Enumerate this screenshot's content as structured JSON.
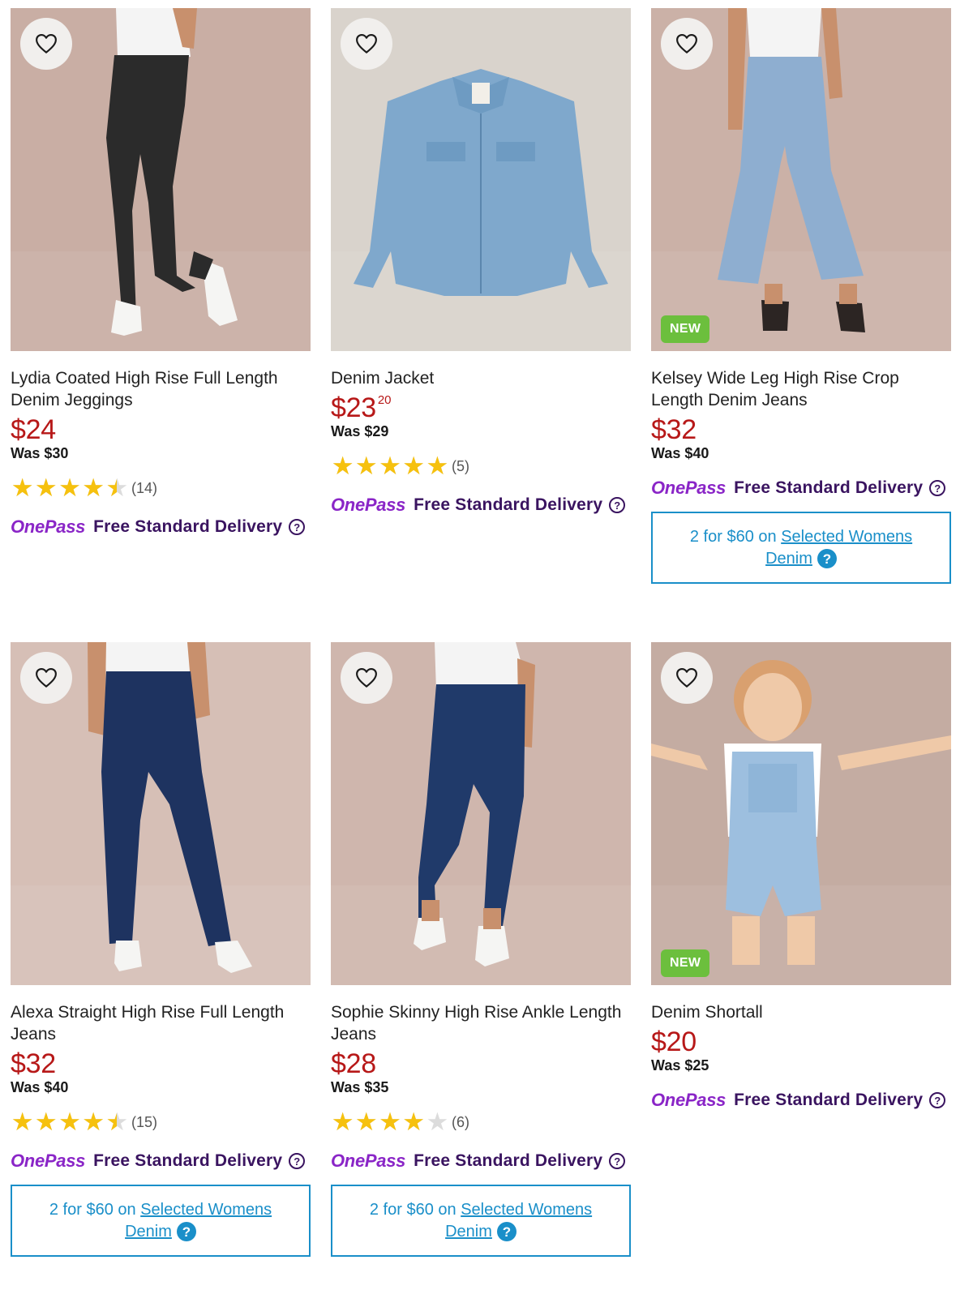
{
  "products": [
    {
      "title": "Lydia Coated High Rise Full Length Denim Jeggings",
      "price": "$24",
      "price_cents": "",
      "was": "Was $30",
      "rating": 4.5,
      "rating_count": "(14)",
      "badge": "",
      "delivery": {
        "brand": "OnePass",
        "text": "Free Standard Delivery",
        "help": "?"
      },
      "promo": null,
      "image": {
        "bg": "#c9aea4",
        "type": "jeggings",
        "color": "#2b2b2b"
      }
    },
    {
      "title": "Denim Jacket",
      "price": "$23",
      "price_cents": "20",
      "was": "Was $29",
      "rating": 5,
      "rating_count": "(5)",
      "badge": "",
      "delivery": {
        "brand": "OnePass",
        "text": "Free Standard Delivery",
        "help": "?"
      },
      "promo": null,
      "image": {
        "bg": "#d9d3cc",
        "type": "jacket",
        "color": "#7fa8cc"
      }
    },
    {
      "title": "Kelsey Wide Leg High Rise Crop Length Denim Jeans",
      "price": "$32",
      "price_cents": "",
      "was": "Was $40",
      "rating": null,
      "rating_count": "",
      "badge": "NEW",
      "delivery": {
        "brand": "OnePass",
        "text": "Free Standard Delivery",
        "help": "?"
      },
      "promo": {
        "prefix": "2 for $60 on",
        "link1": "Selected Womens",
        "link2": "Denim",
        "help": "?"
      },
      "image": {
        "bg": "#cbb1a7",
        "type": "wideleg",
        "color": "#8eaed0"
      }
    },
    {
      "title": "Alexa Straight High Rise Full Length Jeans",
      "price": "$32",
      "price_cents": "",
      "was": "Was $40",
      "rating": 4.5,
      "rating_count": "(15)",
      "badge": "",
      "delivery": {
        "brand": "OnePass",
        "text": "Free Standard Delivery",
        "help": "?"
      },
      "promo": {
        "prefix": "2 for $60 on",
        "link1": "Selected Womens",
        "link2": "Denim",
        "help": "?"
      },
      "image": {
        "bg": "#d6bfb6",
        "type": "straight",
        "color": "#1e3360"
      }
    },
    {
      "title": "Sophie Skinny High Rise Ankle Length Jeans",
      "price": "$28",
      "price_cents": "",
      "was": "Was $35",
      "rating": 4,
      "rating_count": "(6)",
      "badge": "",
      "delivery": {
        "brand": "OnePass",
        "text": "Free Standard Delivery",
        "help": "?"
      },
      "promo": {
        "prefix": "2 for $60 on",
        "link1": "Selected Womens",
        "link2": "Denim",
        "help": "?"
      },
      "image": {
        "bg": "#cfb6ad",
        "type": "skinny",
        "color": "#203a6a"
      }
    },
    {
      "title": "Denim Shortall",
      "price": "$20",
      "price_cents": "",
      "was": "Was $25",
      "rating": null,
      "rating_count": "",
      "badge": "NEW",
      "delivery": {
        "brand": "OnePass",
        "text": "Free Standard Delivery",
        "help": "?"
      },
      "promo": null,
      "image": {
        "bg": "#c4aca2",
        "type": "shortall",
        "color": "#9dbfdf"
      }
    }
  ],
  "icons": {
    "favourite": "heart-outline-icon",
    "star": "star-icon",
    "help": "question-circle-icon"
  },
  "colors": {
    "price": "#b71818",
    "onepass": "#8a25c7",
    "delivery": "#3a1460",
    "promo": "#1a8fc9",
    "new_badge": "#6cbf3d",
    "star": "#f6c10e"
  }
}
